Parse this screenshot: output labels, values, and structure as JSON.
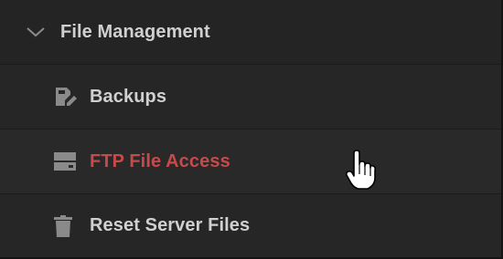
{
  "section": {
    "title": "File Management",
    "expanded_icon": "chevron-down-icon"
  },
  "items": [
    {
      "label": "Backups",
      "icon": "backup-file-icon",
      "active": false
    },
    {
      "label": "FTP File Access",
      "icon": "server-drive-icon",
      "active": true
    },
    {
      "label": "Reset Server Files",
      "icon": "trash-icon",
      "active": false
    }
  ],
  "colors": {
    "text": "#d0d0d0",
    "active_text": "#c64a4a",
    "icon": "#8a8a8a",
    "background": "#262626"
  },
  "cursor": "hand-pointer-cursor"
}
